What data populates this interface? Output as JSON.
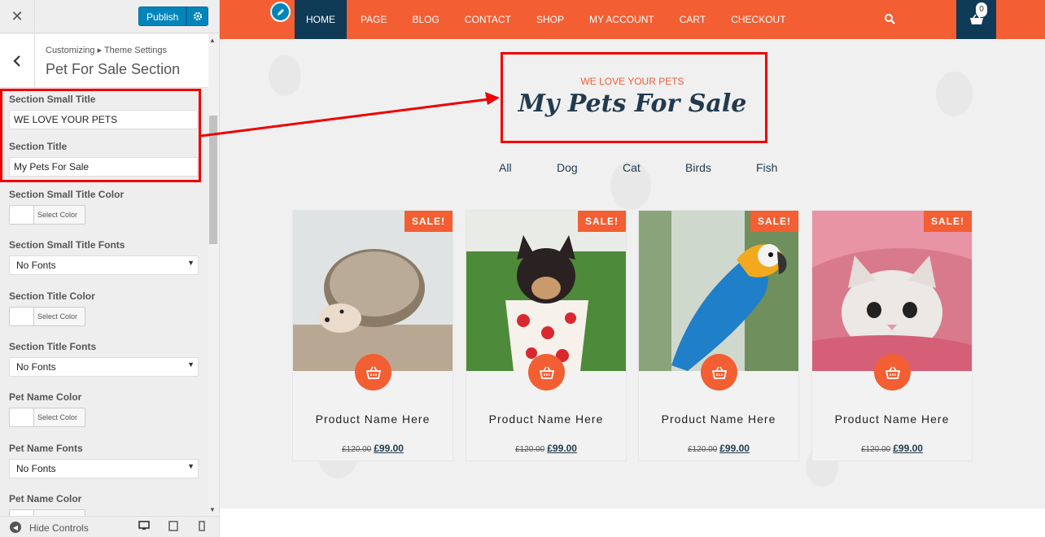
{
  "customizer": {
    "close_label": "✕",
    "publish_label": "Publish",
    "breadcrumb": "Customizing ▸ Theme Settings",
    "panel_title": "Pet For Sale Section",
    "hide_controls": "Hide Controls",
    "select_color_label": "Select Color",
    "fields": {
      "small_title_label": "Section Small Title",
      "small_title_value": "WE LOVE YOUR PETS",
      "title_label": "Section Title",
      "title_value": "My Pets For Sale",
      "small_title_color_label": "Section Small Title Color",
      "small_title_fonts_label": "Section Small Title Fonts",
      "small_title_fonts_value": "No Fonts",
      "title_color_label": "Section Title Color",
      "title_fonts_label": "Section Title Fonts",
      "title_fonts_value": "No Fonts",
      "pet_name_color_label": "Pet Name Color",
      "pet_name_fonts_label": "Pet Name Fonts",
      "pet_name_fonts_value": "No Fonts",
      "pet_name_color2_label": "Pet Name Color"
    }
  },
  "site": {
    "menu": [
      "HOME",
      "PAGE",
      "BLOG",
      "CONTACT",
      "SHOP",
      "MY ACCOUNT",
      "CART",
      "CHECKOUT"
    ],
    "cart_count": "0",
    "small_title": "WE LOVE YOUR PETS",
    "title": "My Pets For Sale",
    "filters": [
      "All",
      "Dog",
      "Cat",
      "Birds",
      "Fish"
    ],
    "sale_badge": "SALE!",
    "products": [
      {
        "name": "Product Name Here",
        "old_price": "£120.00",
        "price": "£99.00",
        "image": "hedgehog"
      },
      {
        "name": "Product Name Here",
        "old_price": "£120.00",
        "price": "£99.00",
        "image": "puppy-in-cup"
      },
      {
        "name": "Product Name Here",
        "old_price": "£120.00",
        "price": "£99.00",
        "image": "parrot"
      },
      {
        "name": "Product Name Here",
        "old_price": "£120.00",
        "price": "£99.00",
        "image": "kitten"
      }
    ]
  },
  "colors": {
    "accent": "#f35e32",
    "navy": "#0f3b57",
    "wp_blue": "#0085ba",
    "highlight": "#ee0000"
  }
}
